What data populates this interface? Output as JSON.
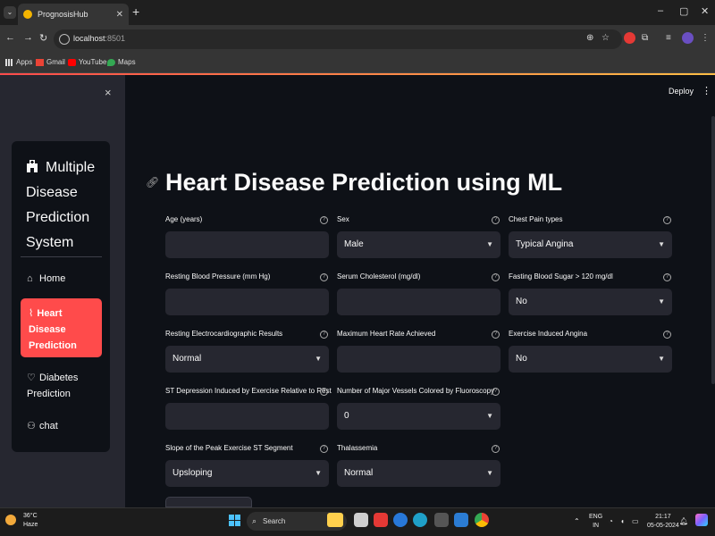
{
  "browser": {
    "tab_title": "PrognosisHub",
    "url_host": "localhost",
    "url_port": ":8501",
    "bookmarks": [
      "Apps",
      "Gmail",
      "YouTube",
      "Maps"
    ],
    "colors": {
      "accent_start": "#ff4b4b",
      "accent_end": "#ffbd45"
    }
  },
  "sidebar": {
    "close_icon": "×",
    "menu_title": "Multiple Disease Prediction System",
    "items": [
      {
        "label": "Home",
        "icon": "home-icon",
        "active": false
      },
      {
        "label": "Heart Disease Prediction",
        "icon": "pulse-icon",
        "active": true
      },
      {
        "label": "Diabetes Prediction",
        "icon": "heart-outline-icon",
        "active": false
      },
      {
        "label": "chat",
        "icon": "person-icon",
        "active": false
      }
    ],
    "active_color": "#ff4b4b"
  },
  "header": {
    "deploy_label": "Deploy"
  },
  "main": {
    "title": "Heart Disease Prediction using ML",
    "fields": [
      {
        "label": "Age (years)",
        "type": "input",
        "value": ""
      },
      {
        "label": "Sex",
        "type": "select",
        "value": "Male"
      },
      {
        "label": "Chest Pain types",
        "type": "select",
        "value": "Typical Angina"
      },
      {
        "label": "Resting Blood Pressure (mm Hg)",
        "type": "input",
        "value": ""
      },
      {
        "label": "Serum Cholesterol (mg/dl)",
        "type": "input",
        "value": ""
      },
      {
        "label": "Fasting Blood Sugar > 120 mg/dl",
        "type": "select",
        "value": "No"
      },
      {
        "label": "Resting Electrocardiographic Results",
        "type": "select",
        "value": "Normal"
      },
      {
        "label": "Maximum Heart Rate Achieved",
        "type": "input",
        "value": ""
      },
      {
        "label": "Exercise Induced Angina",
        "type": "select",
        "value": "No"
      },
      {
        "label": "ST Depression Induced by Exercise Relative to Rest",
        "type": "input",
        "value": ""
      },
      {
        "label": "Number of Major Vessels Colored by Fluoroscopy",
        "type": "select",
        "value": "0"
      },
      {
        "label": "Slope of the Peak Exercise ST Segment",
        "type": "select",
        "value": "Upsloping"
      },
      {
        "label": "Thalassemia",
        "type": "select",
        "value": "Normal"
      }
    ]
  },
  "taskbar": {
    "weather_temp": "36°C",
    "weather_desc": "Haze",
    "search_label": "Search",
    "lang_1": "ENG",
    "lang_2": "IN",
    "time": "21:17",
    "date": "05-05-2024"
  }
}
